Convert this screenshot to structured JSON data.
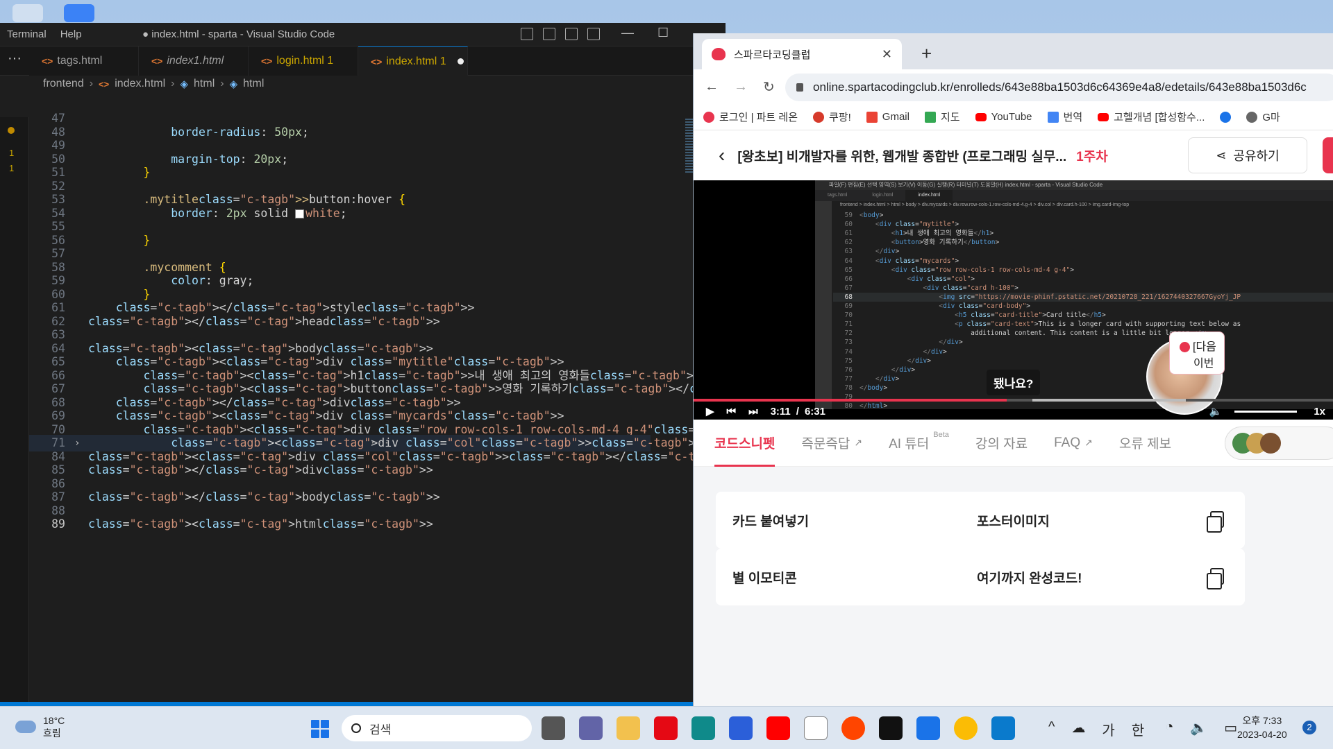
{
  "vscode": {
    "menu": [
      "Terminal",
      "Help"
    ],
    "window_title": "● index.html - sparta - Visual Studio Code",
    "tabs": [
      {
        "label": "tags.html",
        "suffix": ""
      },
      {
        "label": "index1.html",
        "suffix": ""
      },
      {
        "label": "login.html 1",
        "suffix": ""
      },
      {
        "label": "index.html 1",
        "suffix": "dirty"
      }
    ],
    "breadcrumb": [
      "frontend",
      "index.html",
      "html",
      "html"
    ],
    "gutter_marks": [
      "1",
      "1"
    ],
    "lines": [
      {
        "n": "47",
        "code": ""
      },
      {
        "n": "48",
        "code": "            border-radius: 50px;"
      },
      {
        "n": "49",
        "code": ""
      },
      {
        "n": "50",
        "code": "            margin-top: 20px;"
      },
      {
        "n": "51",
        "code": "        }"
      },
      {
        "n": "52",
        "code": ""
      },
      {
        "n": "53",
        "code": "        .mytitle>button:hover {"
      },
      {
        "n": "54",
        "code": "            border: 2px solid white;"
      },
      {
        "n": "55",
        "code": ""
      },
      {
        "n": "56",
        "code": "        }"
      },
      {
        "n": "57",
        "code": ""
      },
      {
        "n": "58",
        "code": "        .mycomment {"
      },
      {
        "n": "59",
        "code": "            color: gray;"
      },
      {
        "n": "60",
        "code": "        }"
      },
      {
        "n": "61",
        "code": "    </style>"
      },
      {
        "n": "62",
        "code": "</head>"
      },
      {
        "n": "63",
        "code": ""
      },
      {
        "n": "64",
        "code": "<body>"
      },
      {
        "n": "65",
        "code": "    <div class=\"mytitle\">"
      },
      {
        "n": "66",
        "code": "        <h1>내 생애 최고의 영화들</h1>"
      },
      {
        "n": "67",
        "code": "        <button>영화 기록하기</button>"
      },
      {
        "n": "68",
        "code": "    </div>"
      },
      {
        "n": "69",
        "code": "    <div class=\"mycards\">"
      },
      {
        "n": "70",
        "code": "        <div class=\"row row-cols-1 row-cols-md-4 g-4\">"
      },
      {
        "n": "71",
        "code": "            <div class=\"col\"></div>"
      },
      {
        "n": "84",
        "code": "<div class=\"col\"></div>"
      },
      {
        "n": "85",
        "code": "</div>"
      },
      {
        "n": "86",
        "code": ""
      },
      {
        "n": "87",
        "code": "</body>"
      },
      {
        "n": "88",
        "code": ""
      },
      {
        "n": "89",
        "code": "<html>"
      }
    ],
    "folded_ellipsis": "···"
  },
  "chrome": {
    "tab_title": "스파르타코딩클럽",
    "url": "online.spartacodingclub.kr/enrolleds/643e88ba1503d6c64369e4a8/edetails/643e88ba1503d6c",
    "bookmarks": [
      "로그인 | 파트 레온",
      "쿠팡!",
      "Gmail",
      "지도",
      "YouTube",
      "번역",
      "고헬개념 [합성함수...",
      "",
      "G마"
    ],
    "course_title": "[왕초보] 비개발자를 위한, 웹개발 종합반 (프로그래밍 실무...",
    "course_week": "1주차",
    "share_label": "공유하기",
    "next_popup": [
      "[다음",
      "이번"
    ],
    "video": {
      "subtitle": "됐나요?",
      "current_time": "3:11",
      "separator": "/",
      "duration": "6:31",
      "speed": "1x",
      "progress_fraction": 0.489,
      "menu_text": "파일(F)  편집(E)  선택 영역(S)  보기(V)  이동(G)  실행(R)  터미널(T)  도움말(H)          index.html - sparta - Visual Studio Code",
      "tabs": [
        "tags.html",
        "login.html",
        "index.html"
      ],
      "crumb": "frontend > index.html > html > body > div.mycards > div.row.row-cols-1.row-cols-md-4.g-4 > div.col > div.card.h-100 > img.card-img-top",
      "code": [
        {
          "n": "59",
          "t": "<body>"
        },
        {
          "n": "60",
          "t": "    <div class=\"mytitle\">"
        },
        {
          "n": "61",
          "t": "        <h1>내 생애 최고의 영화들</h1>"
        },
        {
          "n": "62",
          "t": "        <button>영화 기록하기</button>"
        },
        {
          "n": "63",
          "t": "    </div>"
        },
        {
          "n": "64",
          "t": "    <div class=\"mycards\">"
        },
        {
          "n": "65",
          "t": "        <div class=\"row row-cols-1 row-cols-md-4 g-4\">"
        },
        {
          "n": "66",
          "t": "            <div class=\"col\">"
        },
        {
          "n": "67",
          "t": "                <div class=\"card h-100\">"
        },
        {
          "n": "68",
          "t": "                    <img src=\"https://movie-phinf.pstatic.net/20210728_221/1627440327667GyoYj_JP"
        },
        {
          "n": "69",
          "t": "                    <div class=\"card-body\">"
        },
        {
          "n": "70",
          "t": "                        <h5 class=\"card-title\">Card title</h5>"
        },
        {
          "n": "71",
          "t": "                        <p class=\"card-text\">This is a longer card with supporting text below as"
        },
        {
          "n": "72",
          "t": "                            additional content. This content is a little bit longer.</p>"
        },
        {
          "n": "73",
          "t": "                    </div>"
        },
        {
          "n": "74",
          "t": "                </div>"
        },
        {
          "n": "75",
          "t": "            </div>"
        },
        {
          "n": "76",
          "t": "        </div>"
        },
        {
          "n": "77",
          "t": "    </div>"
        },
        {
          "n": "78",
          "t": "</body>"
        },
        {
          "n": "79",
          "t": ""
        },
        {
          "n": "80",
          "t": "</html>"
        }
      ]
    },
    "lecture_tabs": [
      {
        "label": "코드스니펫",
        "active": true,
        "extra": ""
      },
      {
        "label": "즉문즉답",
        "active": false,
        "extra": "ext"
      },
      {
        "label": "AI 튜터",
        "active": false,
        "extra": "Beta"
      },
      {
        "label": "강의 자료",
        "active": false,
        "extra": ""
      },
      {
        "label": "FAQ",
        "active": false,
        "extra": "ext"
      },
      {
        "label": "오류 제보",
        "active": false,
        "extra": ""
      }
    ],
    "snippets": [
      "카드 붙여넣기",
      "포스터이미지",
      "별 이모티콘",
      "여기까지 완성코드!"
    ]
  },
  "taskbar": {
    "weather_temp": "18°C",
    "weather_desc": "흐림",
    "search_placeholder": "검색",
    "tray": [
      "^",
      "가",
      "한"
    ],
    "time": "오후 7:33",
    "date": "2023-04-20",
    "notifications": "2"
  },
  "colors": {
    "accent": "#e8344e",
    "vscode_bg": "#1e1e1e",
    "vscode_blue": "#0078d4"
  }
}
